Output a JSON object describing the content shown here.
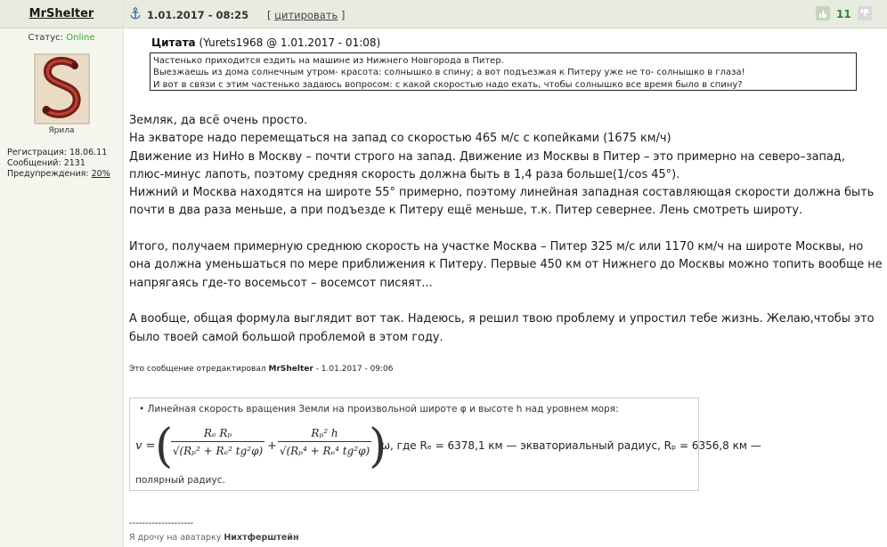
{
  "user": {
    "name": "MrShelter",
    "status_label": "Статус:",
    "status_value": "Online",
    "avatar_caption": "Ярила",
    "registration_label": "Регистрация:",
    "registration_value": "18.06.11",
    "messages_label": "Сообщений:",
    "messages_value": "2131",
    "warnings_label": "Предупреждения:",
    "warnings_value": "20%"
  },
  "post": {
    "date": "1.01.2017 - 08:25",
    "quote_button": "цитировать",
    "rating": "11",
    "quote": {
      "label": "Цитата",
      "source": "(Yurets1968 @ 1.01.2017 - 01:08)",
      "lines": [
        "Частенько приходится ездить на машине из Нижнего Новгорода в Питер.",
        "Выезжаешь из дома солнечным утром- красота: солнышко в спину; а вот подъезжая к Питеру уже не то- солнышко в глаза!",
        "И вот в связи с этим частенько задаюсь вопросом: с какой скоростью надо ехать, чтобы солнышко все время было в спину?"
      ]
    },
    "body_lines": [
      "Земляк, да всё очень просто.",
      "На экваторе надо перемещаться на запад со скоростью 465 м/с с копейками (1675 км/ч)",
      "Движение из НиНо в Москву – почти строго на запад. Движение из Москвы в Питер – это примерно на северо–запад,",
      "плюс-минус лапоть, поэтому средняя скорость должна быть в 1,4 раза больше(1/cos 45°).",
      "Нижний и Москва находятся на широте 55° примерно, поэтому линейная западная составляющая скорости должна быть",
      "почти в два раза меньше, а при подъезде к Питеру ещё меньше, т.к. Питер севернее. Лень смотреть широту.",
      "",
      "Итого, получаем примерную среднюю скорость на участке Москва – Питер 325 м/с или 1170 км/ч на широте Москвы, но",
      "она должна уменьшаться по мере приближения к Питеру. Первые 450 км от Нижнего до Москвы можно топить вообще не",
      "напрягаясь где-то восемьсот – восемсот писяят...",
      "",
      "А вообще, общая формула выглядит вот так. Надеюсь, я решил твою проблему и упростил тебе жизнь. Желаю,чтобы это",
      "было твоей самой большой проблемой в этом году."
    ],
    "edited_prefix": "Это сообщение отредактировал",
    "edited_by": "MrShelter",
    "edited_date": "- 1.01.2017 - 09:06",
    "formula": {
      "intro": "• Линейная скорость вращения Земли на произвольной широте φ и высоте h над уровнем моря:",
      "v": "v =",
      "frac1_num": "Rₑ Rₚ",
      "frac1_den": "√(Rₚ² + Rₑ² tg²φ)",
      "plus": "+",
      "frac2_num": "Rₚ² h",
      "frac2_den": "√(Rₚ⁴ + Rₑ⁴ tg²φ)",
      "omega_text": "ω, где Rₑ = 6378,1 км — экваториальный радиус, Rₚ = 6356,8 км —",
      "tail": "полярный радиус."
    },
    "signature_separator": "--------------------",
    "signature_prefix": "Я дрочу на аватарку",
    "signature_name": "Нихтферштейн"
  }
}
